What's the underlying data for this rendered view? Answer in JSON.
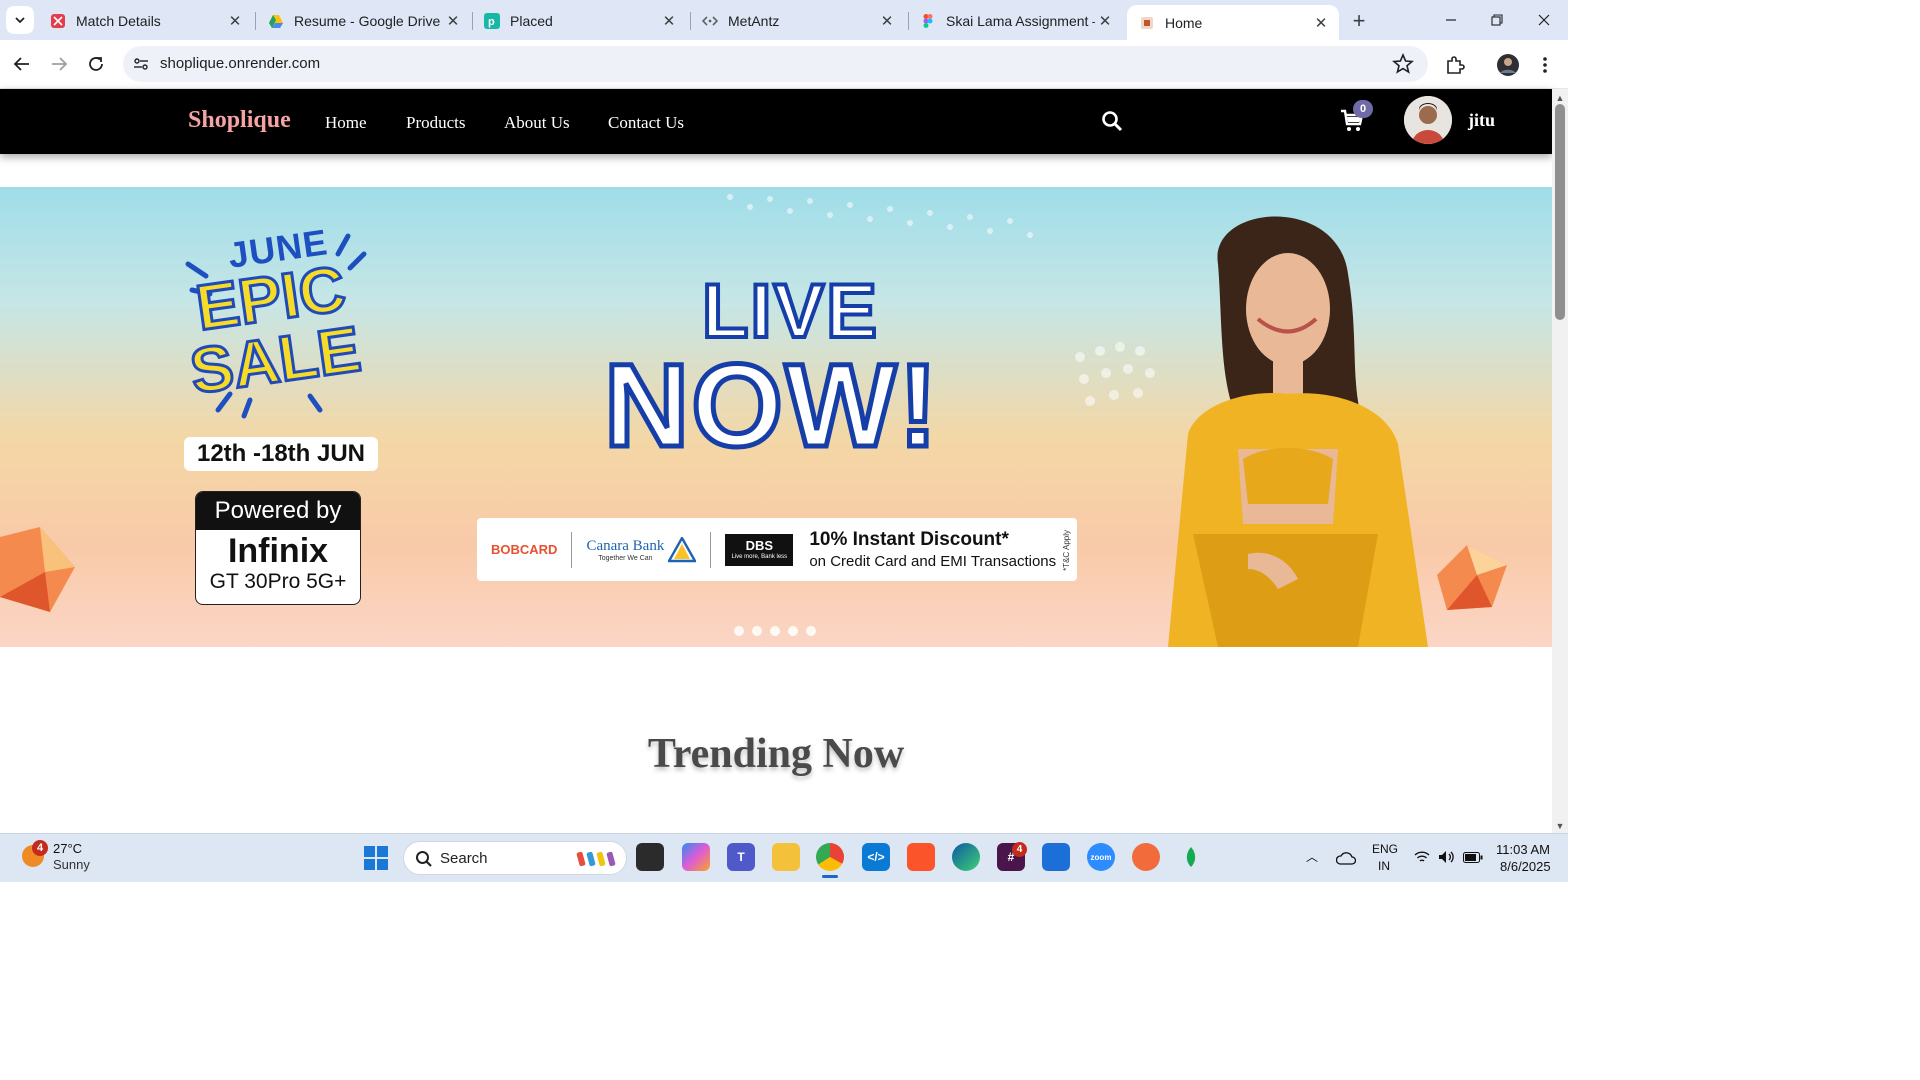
{
  "browser": {
    "tabs": [
      {
        "title": "Match Details",
        "icon": "match-details-favicon",
        "active": false
      },
      {
        "title": "Resume - Google Drive",
        "icon": "google-drive-favicon",
        "active": false
      },
      {
        "title": "Placed",
        "icon": "placed-favicon",
        "active": false
      },
      {
        "title": "MetAntz",
        "icon": "code-favicon",
        "active": false
      },
      {
        "title": "Skai Lama Assignment – Fi",
        "icon": "figma-favicon",
        "active": false
      },
      {
        "title": "Home",
        "icon": "shoplique-favicon",
        "active": true
      }
    ],
    "url": "shoplique.onrender.com"
  },
  "site": {
    "brand": "Shoplique",
    "nav": [
      "Home",
      "Products",
      "About Us",
      "Contact Us"
    ],
    "cart_count": "0",
    "username": "jitu",
    "accent_color": "#f5a3a3"
  },
  "banner": {
    "sale_line1": "JUNE",
    "sale_line2": "EPIC",
    "sale_line3": "SALE",
    "dates": "12th -18th JUN",
    "powered_by": "Powered by",
    "powered_brand": "Infinix",
    "powered_model": "GT 30Pro 5G+",
    "headline_1": "LIVE",
    "headline_2": "NOW!",
    "banks": [
      "BOBCARD",
      "Canara Bank"
    ],
    "bank_tagline": "Together We Can",
    "dbs": "DBS",
    "dbs_tagline": "Live more, Bank less",
    "offer_title": "10% Instant Discount*",
    "offer_sub": "on Credit Card and EMI Transactions",
    "tc": "*T&C Apply",
    "slide_count": 5
  },
  "section_title": "Trending Now",
  "taskbar": {
    "weather_temp": "27°C",
    "weather_desc": "Sunny",
    "weather_badge": "4",
    "search_label": "Search",
    "slack_badge": "4",
    "lang_1": "ENG",
    "lang_2": "IN",
    "time": "11:03 AM",
    "date": "8/6/2025"
  }
}
